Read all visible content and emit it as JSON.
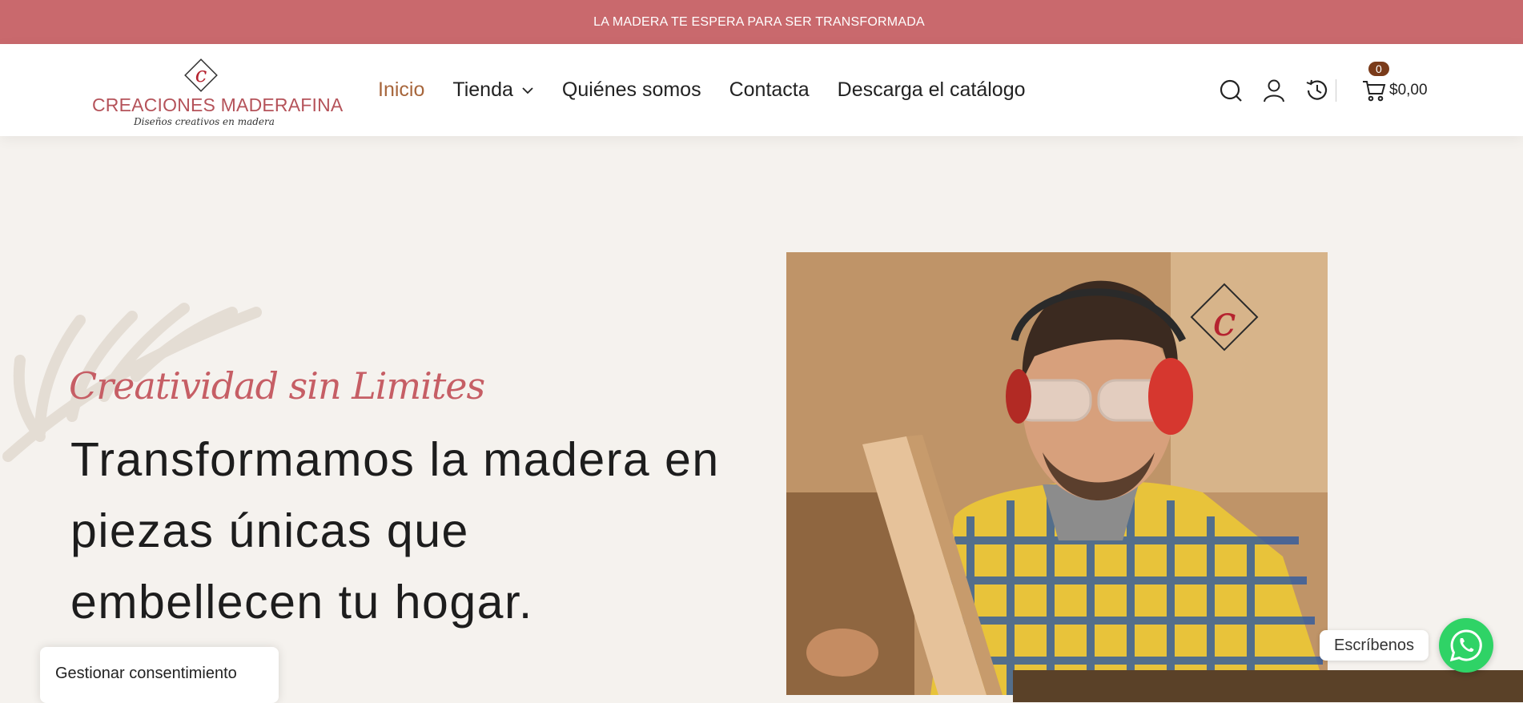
{
  "announcement": "LA MADERA TE ESPERA PARA SER TRANSFORMADA",
  "logo": {
    "letter": "c",
    "name": "CREACIONES MADERAFINA",
    "tagline": "Diseños creativos en madera"
  },
  "nav": {
    "items": [
      {
        "label": "Inicio",
        "active": true
      },
      {
        "label": "Tienda",
        "has_dropdown": true
      },
      {
        "label": "Quiénes somos"
      },
      {
        "label": "Contacta"
      },
      {
        "label": "Descarga el catálogo"
      }
    ]
  },
  "header_icons": [
    "search-icon",
    "user-icon",
    "history-icon",
    "cart-icon"
  ],
  "cart": {
    "count": "0",
    "total": "$0,00"
  },
  "hero": {
    "script_title": "Creatividad sin Limites",
    "heading": "Transformamos la madera en piezas únicas que embellecen tu hogar."
  },
  "consent": {
    "label": "Gestionar consentimiento"
  },
  "chat": {
    "label": "Escríbenos"
  },
  "colors": {
    "brand": "#c9696d",
    "accent": "#a7663c",
    "background": "#f5f2ee",
    "whatsapp": "#2fd366"
  }
}
